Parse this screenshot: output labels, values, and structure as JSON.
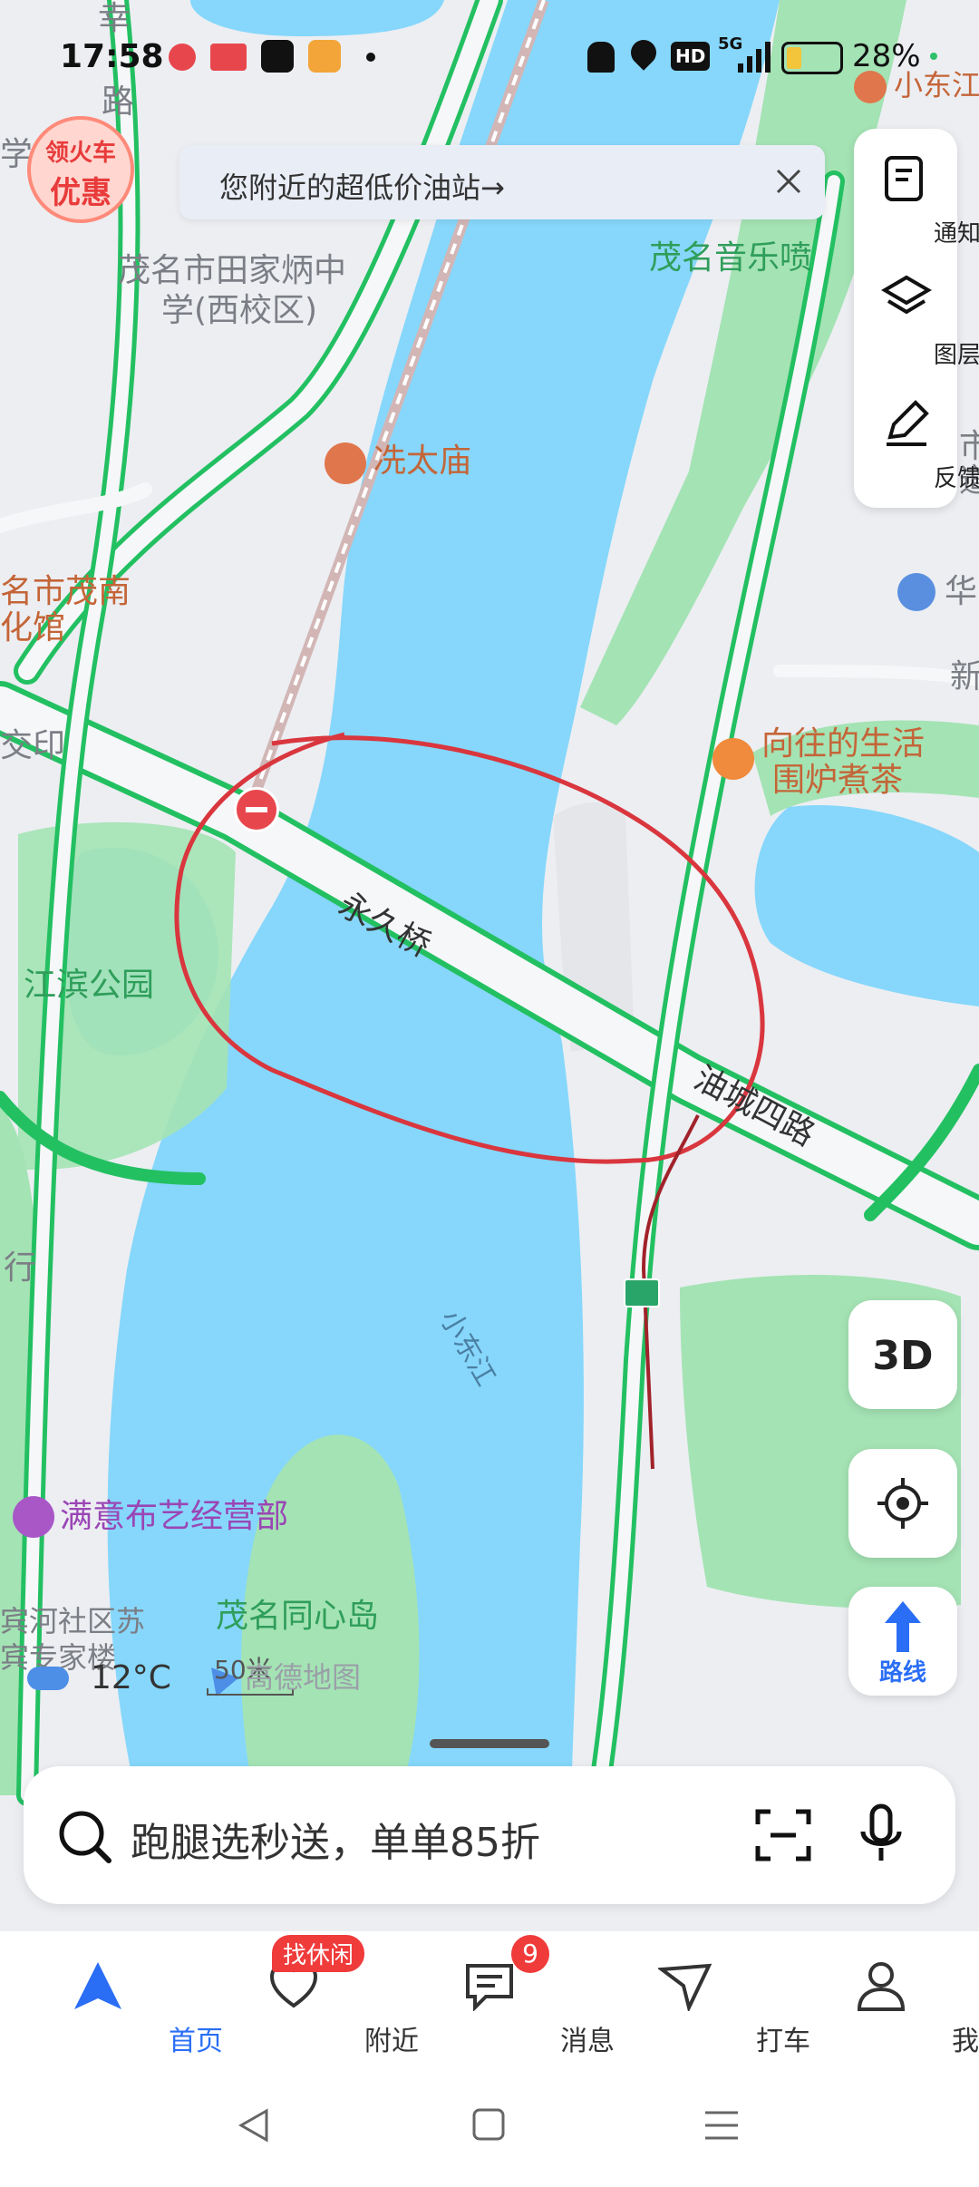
{
  "status_bar": {
    "time": "17:58",
    "network": "5G",
    "hd_label": "HD",
    "battery_pct": "28%",
    "battery_level": 0.28
  },
  "promo_badge": {
    "line1": "领火车",
    "line2": "优惠"
  },
  "banner": {
    "text": "您附近的超低价油站→"
  },
  "side_panel": {
    "notify": "通知",
    "layers": "图层",
    "feedback": "反馈"
  },
  "map_labels": {
    "school_line1": "茂名市田家炳中",
    "school_line2": "学(西校区)",
    "temple": "冼太庙",
    "music_fountain": "茂名音乐喷",
    "culture_line1": "名市茂南",
    "culture_line2": "化馆",
    "teahouse_line1": "向往的生活",
    "teahouse_line2": "围炉煮茶",
    "bridge": "永久桥",
    "road": "油城四路",
    "park": "江滨公园",
    "river": "小东江",
    "shop": "满意布艺经营部",
    "island": "茂名同心岛",
    "community_line1": "宾河社区苏",
    "community_line2": "宾专家楼",
    "top_right_poi": "小东江",
    "right_poi": "华",
    "edge_xing": "行",
    "edge_xin": "新",
    "edge_jiao": "交印",
    "edge_xue": "学",
    "edge_lu": "路",
    "edge_xing2": "幸",
    "edge_shi": "市",
    "edge_dao": "道"
  },
  "weather": {
    "temp": "12°C"
  },
  "scale": {
    "text": "50米"
  },
  "watermark": "高德地图",
  "buttons": {
    "view_3d": "3D",
    "route": "路线"
  },
  "search": {
    "placeholder": "跑腿选秒送，单单85折"
  },
  "bottom_nav": [
    {
      "label": "首页"
    },
    {
      "label": "附近",
      "badge": "找休闲"
    },
    {
      "label": "消息",
      "badge": "9"
    },
    {
      "label": "打车"
    },
    {
      "label": "我的"
    }
  ],
  "colors": {
    "accent": "#2a6ef5",
    "water": "#86d7fb",
    "park": "#a4e3b4",
    "road_border": "#23c062",
    "annotation_red": "#d9363e",
    "badge_red": "#f03b3b"
  }
}
